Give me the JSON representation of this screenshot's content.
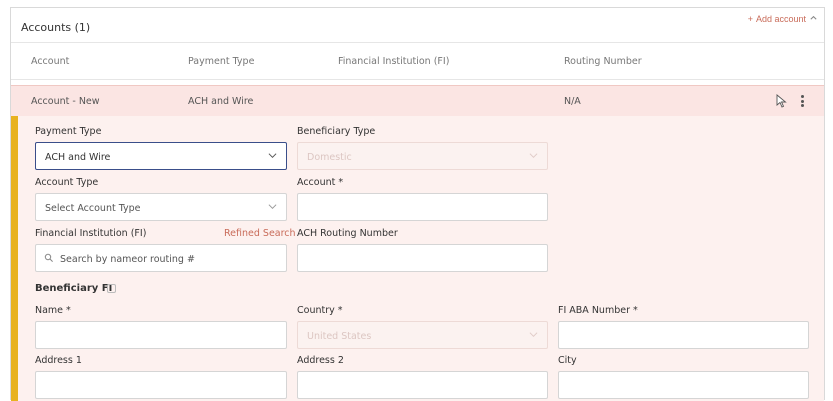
{
  "header": {
    "title": "Accounts (1)",
    "add_label": "Add account"
  },
  "columns": [
    "Account",
    "Payment Type",
    "Financial Institution (FI)",
    "Routing Number"
  ],
  "selected_row": {
    "account": "Account - New",
    "payment_type": "ACH and Wire",
    "routing": "N/A"
  },
  "form": {
    "payment_type_label": "Payment Type",
    "payment_type_value": "ACH and Wire",
    "beneficiary_type_label": "Beneficiary Type",
    "beneficiary_type_value": "Domestic",
    "account_type_label": "Account Type",
    "account_type_placeholder": "Select Account Type",
    "account_label": "Account *",
    "fi_label": "Financial Institution (FI)",
    "refined_search": "Refined Search",
    "fi_search_placeholder": "Search by nameor routing #",
    "ach_routing_label": "ACH Routing Number",
    "beneficiary_fi_heading": "Beneficiary FI",
    "name_label": "Name *",
    "country_label": "Country *",
    "country_value": "United States",
    "fi_aba_label": "FI ABA Number *",
    "address1_label": "Address 1",
    "address2_label": "Address 2",
    "city_label": "City"
  },
  "colors": {
    "accent": "#e8b21f",
    "selected_row_bg": "#fbe5e3",
    "link": "#c96c5a",
    "focus_border": "#3a4e8a"
  }
}
